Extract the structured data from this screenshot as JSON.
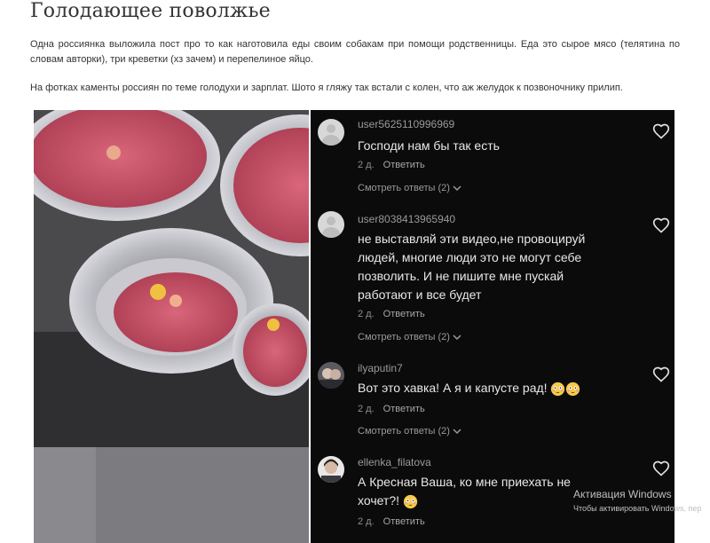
{
  "article": {
    "title": "Голодающее поволжье",
    "paragraph1": "Одна россиянка выложила пост про то как наготовила еды своим собакам при помощи родственницы. Еда это сырое мясо (телятина по словам авторки), три креветки (хз зачем) и перепелиное яйцо.",
    "paragraph2": "На фотках каменты россиян по теме голодухи и зарплат. Шото я гляжу так встали с колен, что аж желудок к позвоночнику прилип."
  },
  "comments": [
    {
      "username": "user5625110996969",
      "text": "Господи нам бы так есть",
      "time": "2 д.",
      "reply_label": "Ответить",
      "view_replies": "Смотреть ответы (2)"
    },
    {
      "username": "user8038413965940",
      "text": "не выставляй эти видео,не провоцируй людей, многие люди это не могут себе позволить. И не пишите мне пускай работают и все будет",
      "time": "2 д.",
      "reply_label": "Ответить",
      "view_replies": "Смотреть ответы (2)"
    },
    {
      "username": "ilyaputin7",
      "text": "Вот это хавка! А я и капусте рад!",
      "time": "2 д.",
      "reply_label": "Ответить",
      "view_replies": "Смотреть ответы (2)"
    },
    {
      "username": "ellenka_filatova",
      "text": "А Кресная Ваша, ко мне приехать не хочет?!",
      "time": "2 д.",
      "reply_label": "Ответить"
    }
  ],
  "icons": {
    "heart": "heart-icon",
    "chevron": "chevron-down-icon",
    "emoji": "flushed-face-emoji"
  },
  "watermark": {
    "line1": "Активация Windows",
    "line2": "Чтобы активировать Windows, пер"
  }
}
